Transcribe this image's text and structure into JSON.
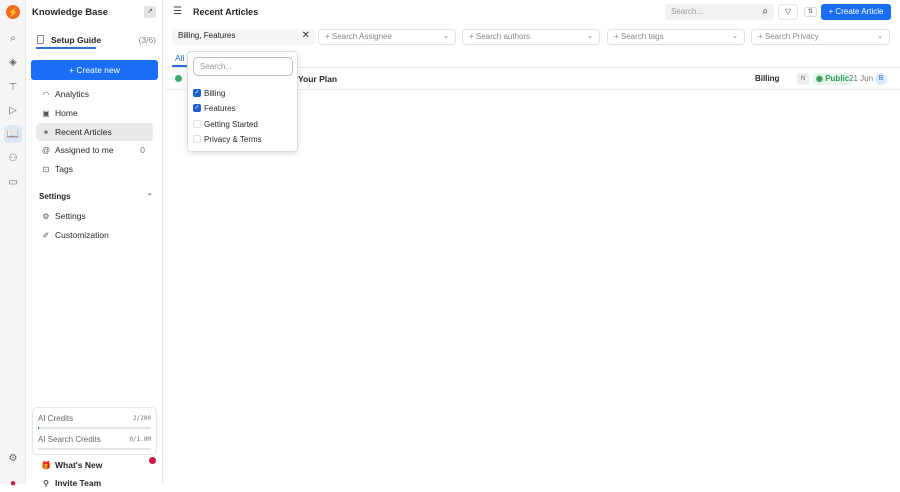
{
  "sidebar": {
    "title": "Knowledge Base",
    "setup_guide": "Setup Guide",
    "setup_progress": "(3/6)",
    "create_new": "+ Create new",
    "items": [
      {
        "label": "Analytics"
      },
      {
        "label": "Home"
      },
      {
        "label": "Recent Articles"
      },
      {
        "label": "Assigned to me",
        "count": "0"
      },
      {
        "label": "Tags"
      }
    ],
    "settings_header": "Settings",
    "settings_items": [
      {
        "label": "Settings"
      },
      {
        "label": "Customization"
      }
    ],
    "credits": [
      {
        "label": "AI Credits",
        "value": "2/200",
        "fraction": 0.01
      },
      {
        "label": "AI Search Credits",
        "value": "0/1.0M",
        "fraction": 0
      }
    ],
    "whats_new": "What's New",
    "invite_team": "Invite Team"
  },
  "header": {
    "title": "Recent Articles",
    "search_placeholder": "Search...",
    "create_article": "+ Create Article"
  },
  "filters": {
    "category_value": "Billing, Features",
    "assignee": "+ Search Assignee",
    "authors": "+ Search authors",
    "tags": "+ Search tags",
    "privacy": "+ Search Privacy"
  },
  "tabs": [
    {
      "label": "All"
    }
  ],
  "rows": [
    {
      "title": "Your Plan",
      "category": "Billing",
      "badge": "N",
      "visibility": "Public",
      "date": "21 Jun",
      "avatar": "B"
    }
  ],
  "dropdown": {
    "search_placeholder": "Search...",
    "options": [
      {
        "label": "Billing",
        "checked": true
      },
      {
        "label": "Features",
        "checked": true
      },
      {
        "label": "Getting Started",
        "checked": false
      },
      {
        "label": "Privacy & Terms",
        "checked": false
      }
    ]
  },
  "colors": {
    "accent": "#1a6ef5",
    "logo": "#f26b1d",
    "public": "#2e9a55"
  }
}
